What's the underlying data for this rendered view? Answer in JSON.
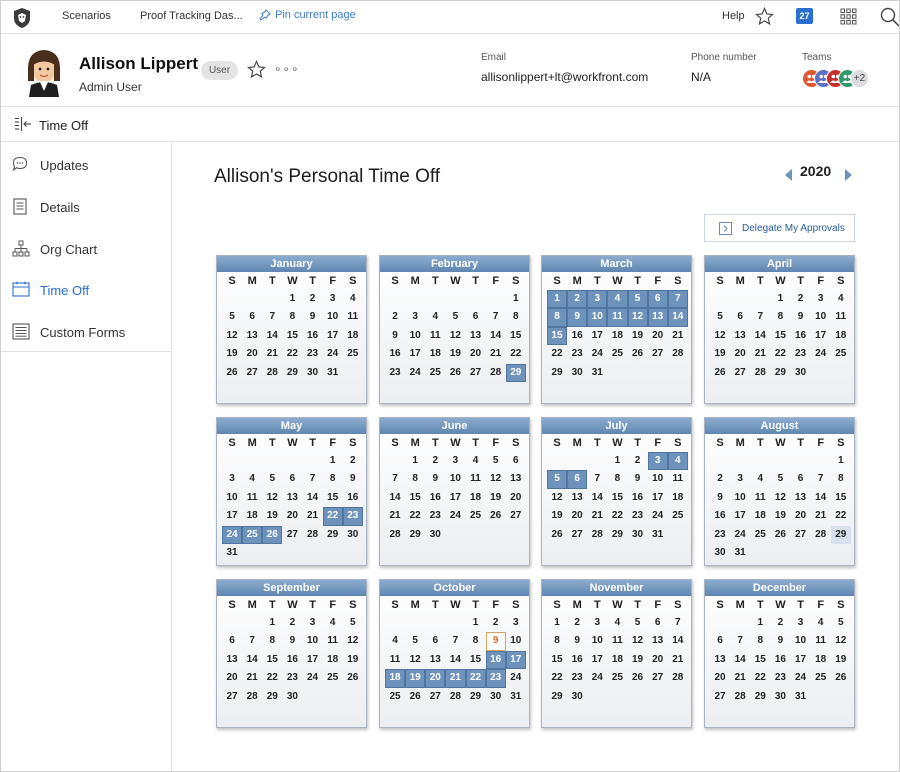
{
  "topnav": {
    "links": [
      "Scenarios",
      "Proof Tracking Das..."
    ],
    "pin_label": "Pin current page",
    "help_label": "Help",
    "calendar_badge": "27"
  },
  "profile": {
    "name": "Allison Lippert",
    "role": "Admin User",
    "badge": "User",
    "more": "∘∘∘",
    "email_label": "Email",
    "email": "allisonlippert+lt@workfront.com",
    "phone_label": "Phone number",
    "phone": "N/A",
    "teams_label": "Teams",
    "teams_colors": [
      "#e0552d",
      "#5b6fc7",
      "#c8302e",
      "#2e9a6a"
    ],
    "teams_more": "+2"
  },
  "breadcrumb": {
    "label": "Time Off"
  },
  "sidebar": {
    "items": [
      {
        "label": "Updates",
        "icon": "comment-icon",
        "active": false
      },
      {
        "label": "Details",
        "icon": "document-icon",
        "active": false
      },
      {
        "label": "Org Chart",
        "icon": "org-chart-icon",
        "active": false
      },
      {
        "label": "Time Off",
        "icon": "calendar-icon",
        "active": true
      },
      {
        "label": "Custom Forms",
        "icon": "form-icon",
        "active": false
      }
    ]
  },
  "main": {
    "title": "Allison's Personal Time Off",
    "year": "2020",
    "delegate_label": "Delegate My Approvals"
  },
  "calendar": {
    "weekday_labels": [
      "S",
      "M",
      "T",
      "W",
      "T",
      "F",
      "S"
    ],
    "months": [
      {
        "name": "January",
        "start": 3,
        "days": 31,
        "off": []
      },
      {
        "name": "February",
        "start": 6,
        "days": 29,
        "off": [
          29
        ]
      },
      {
        "name": "March",
        "start": 0,
        "days": 31,
        "off": [
          1,
          2,
          3,
          4,
          5,
          6,
          7,
          8,
          9,
          10,
          11,
          12,
          13,
          14,
          15
        ]
      },
      {
        "name": "April",
        "start": 3,
        "days": 30,
        "off": []
      },
      {
        "name": "May",
        "start": 5,
        "days": 31,
        "off": [
          22,
          23,
          24,
          25,
          26
        ]
      },
      {
        "name": "June",
        "start": 1,
        "days": 30,
        "off": []
      },
      {
        "name": "July",
        "start": 3,
        "days": 31,
        "off": [
          3,
          4,
          5,
          6
        ]
      },
      {
        "name": "August",
        "start": 6,
        "days": 31,
        "off": [],
        "highlight": [
          29
        ]
      },
      {
        "name": "September",
        "start": 2,
        "days": 30,
        "off": []
      },
      {
        "name": "October",
        "start": 4,
        "days": 31,
        "off": [
          16,
          17,
          18,
          19,
          20,
          21,
          22,
          23
        ],
        "today": 9
      },
      {
        "name": "November",
        "start": 0,
        "days": 30,
        "off": []
      },
      {
        "name": "December",
        "start": 2,
        "days": 31,
        "off": []
      }
    ]
  }
}
